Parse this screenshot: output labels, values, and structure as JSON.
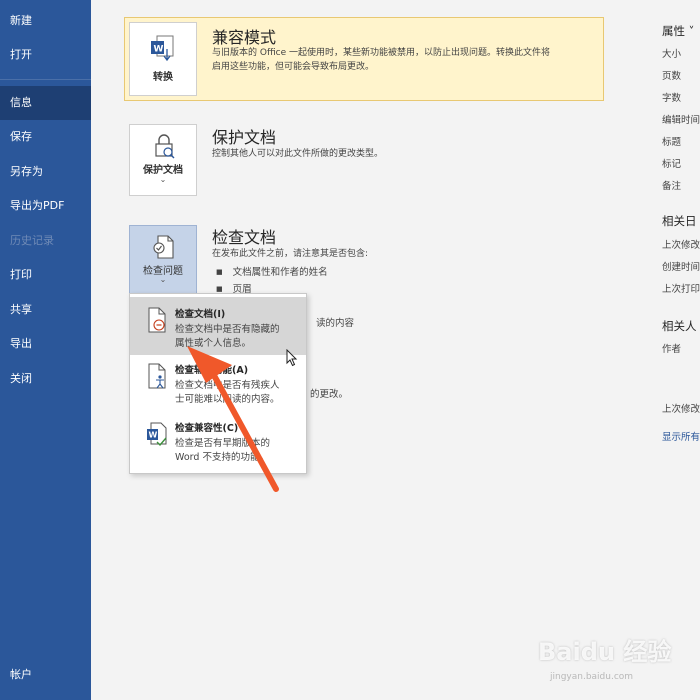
{
  "sidebar": {
    "items": [
      {
        "label": "新建"
      },
      {
        "label": "打开"
      },
      {
        "label": "信息"
      },
      {
        "label": "保存"
      },
      {
        "label": "另存为"
      },
      {
        "label": "导出为PDF"
      },
      {
        "label": "历史记录"
      },
      {
        "label": "打印"
      },
      {
        "label": "共享"
      },
      {
        "label": "导出"
      },
      {
        "label": "关闭"
      },
      {
        "label": "帐户"
      }
    ],
    "active_index": 2,
    "disabled_index": 6,
    "color": "#2b579a"
  },
  "main": {
    "compat": {
      "button_label": "转换",
      "title": "兼容模式",
      "desc_line1": "与旧版本的 Office 一起使用时，某些新功能被禁用，以防止出现问题。转换此文件将",
      "desc_line2": "启用这些功能，但可能会导致布局更改。"
    },
    "protect": {
      "button_label": "保护文档",
      "chevron": "⌄",
      "title": "保护文档",
      "desc": "控制其他人可以对此文件所做的更改类型。"
    },
    "inspect": {
      "button_label": "检查问题",
      "chevron": "⌄",
      "title": "检查文档",
      "desc": "在发布此文件之前，请注意其是否包含:",
      "bullets": [
        "文档属性和作者的姓名",
        "页眉",
        "读的内容"
      ],
      "partial_text": "的更改。"
    }
  },
  "menu": {
    "items": [
      {
        "title": "检查文档(I)",
        "desc": "检查文档中是否有隐藏的属性或个人信息。",
        "icon": "inspect-document-icon"
      },
      {
        "title": "检查辅助功能(A)",
        "desc": "检查文档中是否有残疾人士可能难以阅读的内容。",
        "icon": "accessibility-icon"
      },
      {
        "title": "检查兼容性(C)",
        "desc": "检查是否有早期版本的 Word 不支持的功能。",
        "icon": "compatibility-icon"
      }
    ],
    "menu_item1_title_shown": "检查文档(I)",
    "menu_item1_desc_l1": "检查文档中是否有隐藏的",
    "menu_item1_desc_l2": "属性或个人信息。",
    "menu_item2_title_shown": "检查辅助功能(A)",
    "menu_item2_desc_l1": "检查文档中是否有残疾人",
    "menu_item2_desc_l2": "士可能难以阅读的内容。",
    "menu_item3_title_shown": "检查兼容性(C)",
    "menu_item3_desc_l1": "检查是否有早期版本的",
    "menu_item3_desc_l2": "Word 不支持的功能。"
  },
  "properties": {
    "header": "属性 ˅",
    "rows": [
      "大小",
      "页数",
      "字数",
      "编辑时间",
      "标题",
      "标记",
      "备注"
    ],
    "related_dates_header": "相关日",
    "dates": [
      "上次修改",
      "创建时间",
      "上次打印"
    ],
    "related_people_header": "相关人",
    "people": [
      "作者"
    ],
    "last_modified": "上次修改",
    "show_all": "显示所有"
  },
  "watermark": {
    "logo": "Baidu 经验",
    "url": "jingyan.baidu.com"
  },
  "colors": {
    "accent": "#2b579a",
    "compat_bg": "#fff4cc",
    "arrow": "#f0582a"
  }
}
